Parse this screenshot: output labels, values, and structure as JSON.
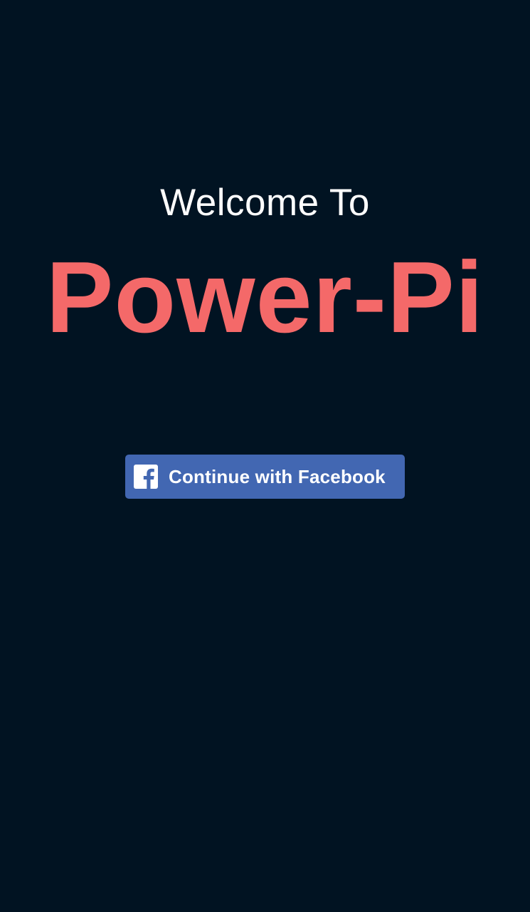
{
  "welcome": {
    "greeting": "Welcome To",
    "app_name": "Power-Pi"
  },
  "login": {
    "facebook_button_label": "Continue with Facebook",
    "facebook_icon": "facebook-icon",
    "button_color": "#4267b2"
  },
  "theme": {
    "background": "#011322",
    "accent": "#f46969",
    "text": "#ffffff"
  }
}
